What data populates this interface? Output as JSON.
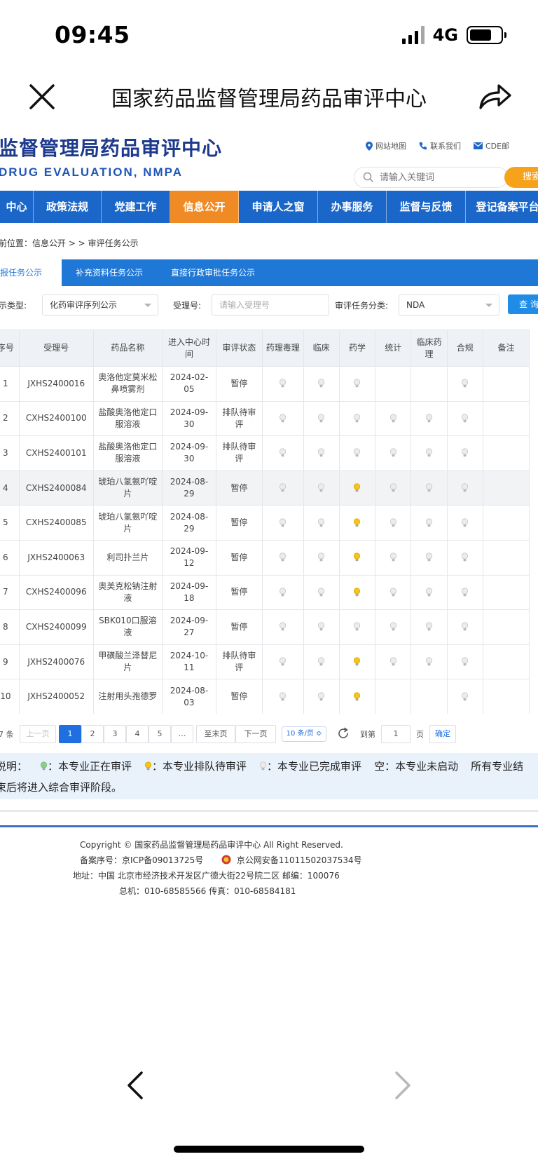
{
  "status_bar": {
    "time": "09:45",
    "network": "4G"
  },
  "wechat": {
    "title": "国家药品监督管理局药品审评中心"
  },
  "site": {
    "name": "监督管理局药品审评中心",
    "subtitle": "DRUG EVALUATION, NMPA",
    "links": [
      "网站地图",
      "联系我们",
      "CDE邮"
    ],
    "search_placeholder": "请输入关键词",
    "search_label": "搜索"
  },
  "nav": {
    "items": [
      {
        "label": "中心",
        "active": false
      },
      {
        "label": "政策法规",
        "active": false
      },
      {
        "label": "党建工作",
        "active": false
      },
      {
        "label": "信息公开",
        "active": true
      },
      {
        "label": "申请人之窗",
        "active": false
      },
      {
        "label": "办事服务",
        "active": false
      },
      {
        "label": "监督与反馈",
        "active": false
      },
      {
        "label": "登记备案平台",
        "active": false
      }
    ]
  },
  "breadcrumb": "前位置：信息公开 > > 审评任务公示",
  "tabs": [
    "报任务公示",
    "补充资料任务公示",
    "直接行政审批任务公示"
  ],
  "filters": {
    "type_label": "示类型:",
    "type_value": "化药审评序列公示",
    "accept_label": "受理号:",
    "accept_placeholder": "请输入受理号",
    "category_label": "审评任务分类:",
    "category_value": "NDA",
    "query_label": "查询"
  },
  "table": {
    "headers": [
      "序号",
      "受理号",
      "药品名称",
      "进入中心时间",
      "审评状态",
      "药理毒理",
      "临床",
      "药学",
      "统计",
      "临床药理",
      "合规",
      "备注"
    ],
    "rows": [
      {
        "no": "1",
        "id": "JXHS2400016",
        "name": "奥洛他定莫米松鼻喷雾剂",
        "date": "2024-02-05",
        "status": "暂停",
        "tox": "done",
        "clinical": "done",
        "pharm": "done",
        "stat": "",
        "clinpharm": "",
        "compliance": "done",
        "note": ""
      },
      {
        "no": "2",
        "id": "CXHS2400100",
        "name": "盐酸奥洛他定口服溶液",
        "date": "2024-09-30",
        "status": "排队待审评",
        "tox": "done",
        "clinical": "done",
        "pharm": "done",
        "stat": "done",
        "clinpharm": "done",
        "compliance": "done",
        "note": ""
      },
      {
        "no": "3",
        "id": "CXHS2400101",
        "name": "盐酸奥洛他定口服溶液",
        "date": "2024-09-30",
        "status": "排队待审评",
        "tox": "done",
        "clinical": "done",
        "pharm": "done",
        "stat": "done",
        "clinpharm": "done",
        "compliance": "done",
        "note": ""
      },
      {
        "no": "4",
        "id": "CXHS2400084",
        "name": "琥珀八氢氨吖啶片",
        "date": "2024-08-29",
        "status": "暂停",
        "tox": "done",
        "clinical": "done",
        "pharm": "queued",
        "stat": "done",
        "clinpharm": "done",
        "compliance": "done",
        "note": ""
      },
      {
        "no": "5",
        "id": "CXHS2400085",
        "name": "琥珀八氢氨吖啶片",
        "date": "2024-08-29",
        "status": "暂停",
        "tox": "done",
        "clinical": "done",
        "pharm": "queued",
        "stat": "done",
        "clinpharm": "done",
        "compliance": "done",
        "note": ""
      },
      {
        "no": "6",
        "id": "JXHS2400063",
        "name": "利司扑兰片",
        "date": "2024-09-12",
        "status": "暂停",
        "tox": "done",
        "clinical": "done",
        "pharm": "queued",
        "stat": "done",
        "clinpharm": "done",
        "compliance": "done",
        "note": ""
      },
      {
        "no": "7",
        "id": "CXHS2400096",
        "name": "奥美克松钠注射液",
        "date": "2024-09-18",
        "status": "暂停",
        "tox": "done",
        "clinical": "done",
        "pharm": "queued",
        "stat": "done",
        "clinpharm": "done",
        "compliance": "done",
        "note": ""
      },
      {
        "no": "8",
        "id": "CXHS2400099",
        "name": "SBK010口服溶液",
        "date": "2024-09-27",
        "status": "暂停",
        "tox": "done",
        "clinical": "done",
        "pharm": "done",
        "stat": "done",
        "clinpharm": "done",
        "compliance": "done",
        "note": ""
      },
      {
        "no": "9",
        "id": "JXHS2400076",
        "name": "甲磺酸兰泽替尼片",
        "date": "2024-10-11",
        "status": "排队待审评",
        "tox": "done",
        "clinical": "done",
        "pharm": "queued",
        "stat": "done",
        "clinpharm": "done",
        "compliance": "done",
        "note": ""
      },
      {
        "no": "10",
        "id": "JXHS2400052",
        "name": "注射用头孢德罗",
        "date": "2024-08-03",
        "status": "暂停",
        "tox": "done",
        "clinical": "done",
        "pharm": "queued",
        "stat": "",
        "clinpharm": "",
        "compliance": "done",
        "note": ""
      }
    ]
  },
  "pagination": {
    "total": "7 条",
    "prev": "上一页",
    "pages": [
      "1",
      "2",
      "3",
      "4",
      "5",
      "…"
    ],
    "last": "至末页",
    "next": "下一页",
    "page_size": "10 条/页 ≎",
    "goto_label": "到第",
    "goto_value": "1",
    "page_unit": "页",
    "confirm": "确定"
  },
  "legend": {
    "prefix": "说明：",
    "in_progress": "：本专业正在审评",
    "queued": "：本专业排队待审评",
    "done": "：本专业已完成审评",
    "empty": "空：本专业未启动",
    "tail": "所有专业结",
    "line2": "束后将进入综合审评阶段。"
  },
  "colors": {
    "bulb_in_progress": "#8ed08a",
    "bulb_queued": "#f5c518",
    "bulb_done": "#d9d9d9",
    "nav_blue": "#1a66c9",
    "nav_active": "#f08a24"
  },
  "footer": {
    "copyright": "Copyright © 国家药品监督管理局药品审评中心   All Right Reserved.",
    "icp": "备案序号：京ICP备09013725号",
    "police": "京公网安备11011502037534号",
    "address": "地址：中国 北京市经济技术开发区广德大街22号院二区      邮编：100076",
    "phone": "总机：010-68585566      传真：010-68584181"
  }
}
